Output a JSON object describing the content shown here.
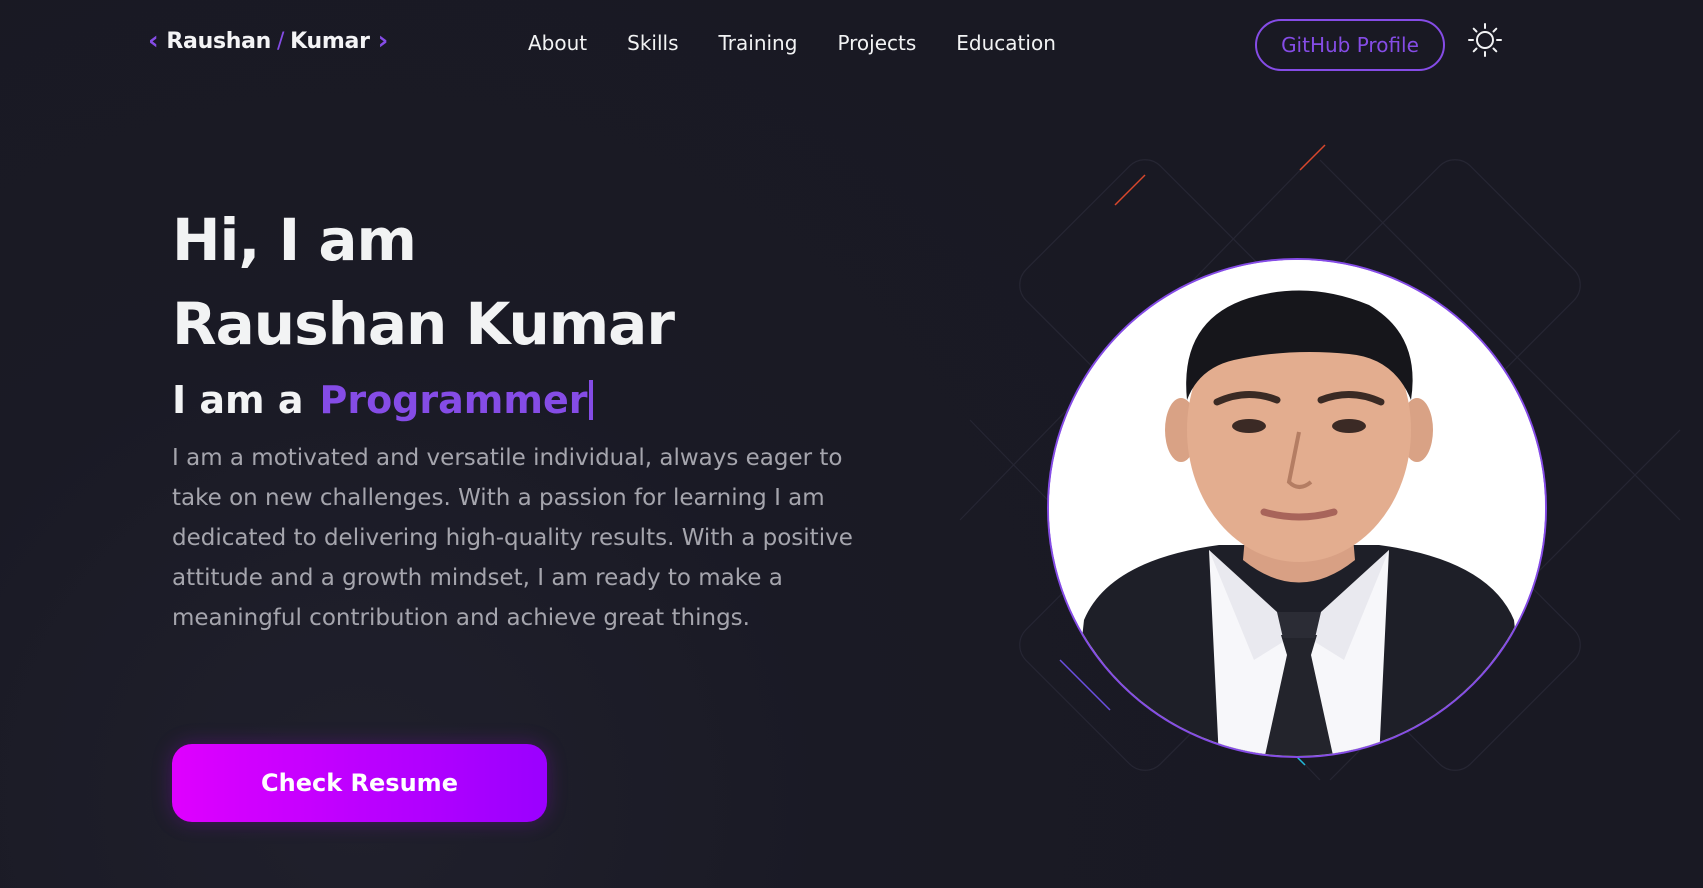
{
  "nav": {
    "logo": {
      "first": "Raushan",
      "separator": "/",
      "last": "Kumar"
    },
    "links": [
      "About",
      "Skills",
      "Training",
      "Projects",
      "Education"
    ],
    "github_button": "GitHub Profile",
    "theme_icon": "sun-icon"
  },
  "hero": {
    "greeting": "Hi, I am",
    "name": "Raushan Kumar",
    "role_prefix": "I am a",
    "role": "Programmer",
    "description": "I am a motivated and versatile individual, always eager to take on new challenges. With a passion for learning I am dedicated to delivering high-quality results. With a positive attitude and a growth mindset, I am ready to make a meaningful contribution and achieve great things.",
    "cta": "Check Resume"
  },
  "colors": {
    "background": "#191923",
    "accent": "#854ce6",
    "text_primary": "#f2f3f4",
    "text_secondary": "#a5a5ad",
    "button_gradient_start": "#df00ff",
    "button_gradient_end": "#9a00ff"
  }
}
